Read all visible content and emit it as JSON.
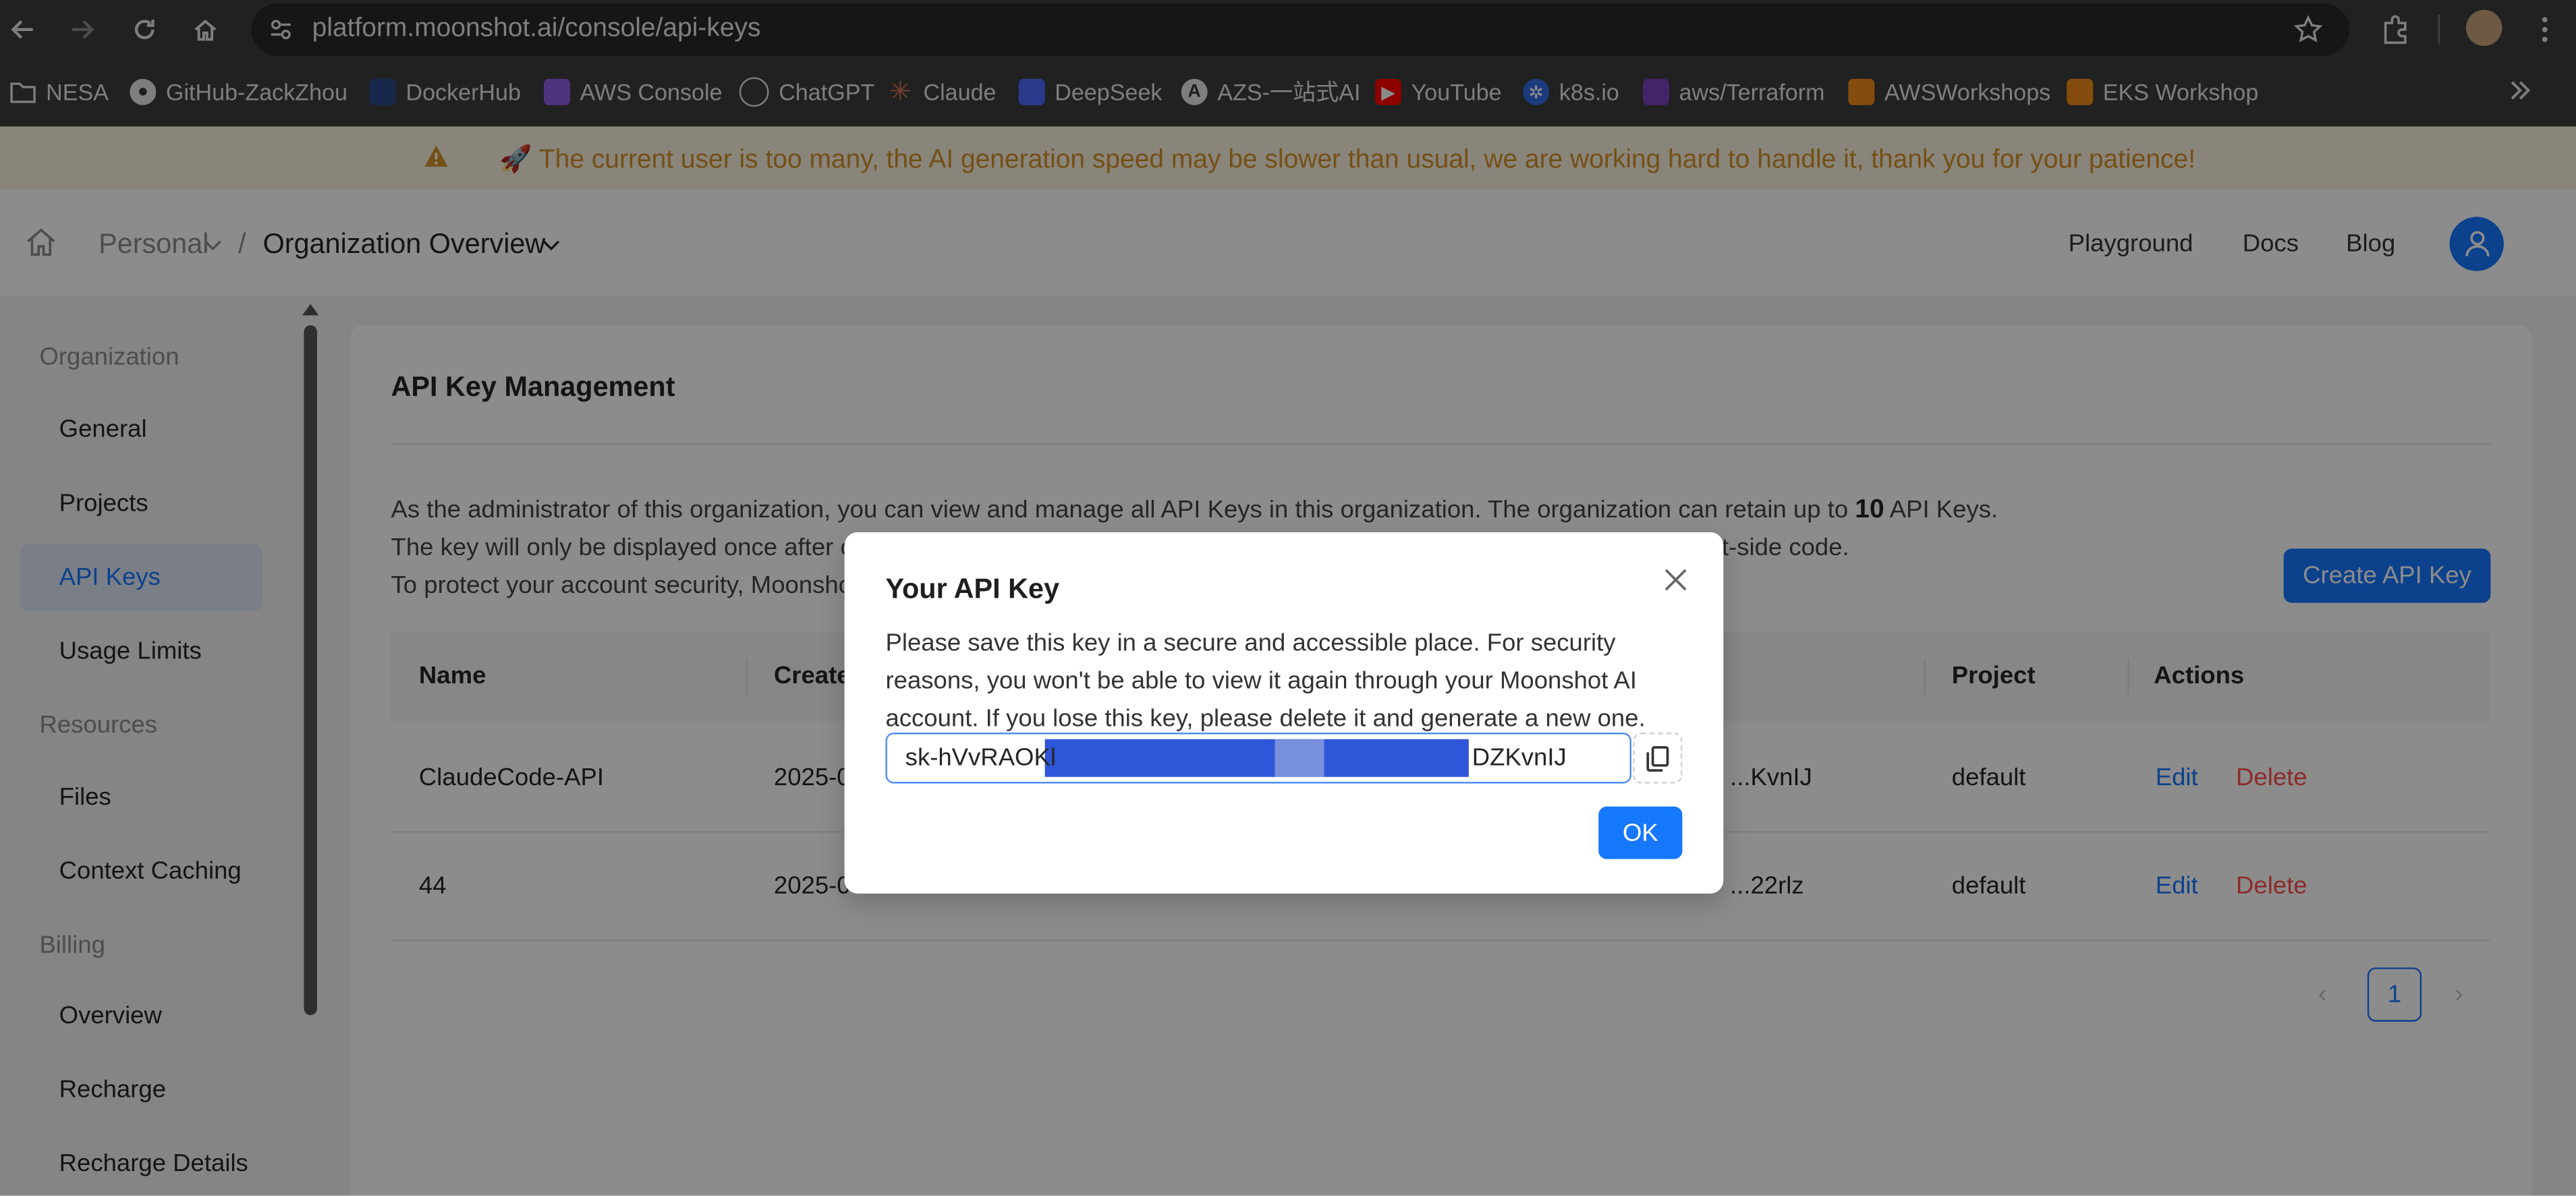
{
  "browser": {
    "url": "platform.moonshot.ai/console/api-keys",
    "bookmarks": [
      {
        "label": "NESA",
        "icon": "folder-icon"
      },
      {
        "label": "GitHub-ZackZhou",
        "icon": "github-icon"
      },
      {
        "label": "DockerHub",
        "icon": "docker-icon"
      },
      {
        "label": "AWS Console",
        "icon": "cube-icon"
      },
      {
        "label": "ChatGPT",
        "icon": "openai-icon"
      },
      {
        "label": "Claude",
        "icon": "claude-icon"
      },
      {
        "label": "DeepSeek",
        "icon": "deepseek-icon"
      },
      {
        "label": "AZS-一站式AI",
        "icon": "azs-icon"
      },
      {
        "label": "YouTube",
        "icon": "youtube-icon"
      },
      {
        "label": "k8s.io",
        "icon": "kubernetes-icon"
      },
      {
        "label": "aws/Terraform",
        "icon": "terraform-icon"
      },
      {
        "label": "AWSWorkshops",
        "icon": "aws-workshops-icon"
      },
      {
        "label": "EKS Workshop",
        "icon": "eks-icon"
      }
    ]
  },
  "banner": {
    "text": "🚀 The current user is too many, the AI generation speed may be slower than usual, we are working hard to handle it, thank you for your patience!"
  },
  "header": {
    "breadcrumb_personal": "Personal",
    "breadcrumb_separator": "/",
    "breadcrumb_org": "Organization Overview",
    "nav": [
      "Playground",
      "Docs",
      "Blog"
    ]
  },
  "sidebar": {
    "sections": [
      {
        "title": "Organization",
        "items": [
          "General",
          "Projects",
          "API Keys",
          "Usage Limits"
        ]
      },
      {
        "title": "Resources",
        "items": [
          "Files",
          "Context Caching"
        ]
      },
      {
        "title": "Billing",
        "items": [
          "Overview",
          "Recharge",
          "Recharge Details"
        ]
      }
    ],
    "active": "API Keys"
  },
  "main": {
    "title": "API Key Management",
    "desc_line1_pre": "As the administrator of this organization, you can view and manage all API Keys in this organization. The organization can retain up to ",
    "desc_line1_bold": "10",
    "desc_line1_post": " API Keys.",
    "desc_line2_start": "The key will only be displayed once after cre",
    "desc_line2_end": "t-side code.",
    "desc_line3_start": "To protect your account security, Moonshot",
    "create_button": "Create API Key",
    "table": {
      "headers": {
        "name": "Name",
        "created": "Created",
        "project": "Project",
        "actions": "Actions"
      },
      "rows": [
        {
          "name": "ClaudeCode-API",
          "created": "2025-0",
          "key_tail": "...KvnIJ",
          "project": "default",
          "edit": "Edit",
          "delete": "Delete"
        },
        {
          "name": "44",
          "created": "2025-0",
          "key_tail": "...22rlz",
          "project": "default",
          "edit": "Edit",
          "delete": "Delete"
        }
      ]
    },
    "pagination": {
      "current": "1"
    }
  },
  "modal": {
    "title": "Your API Key",
    "body": "Please save this key in a secure and accessible place. For security reasons, you won't be able to view it again through your Moonshot AI account. If you lose this key, please delete it and generate a new one.",
    "key_prefix": "sk-hVvRAOKl",
    "key_suffix": "DZKvnIJ",
    "ok_button": "OK"
  },
  "colors": {
    "primary": "#1677ff",
    "danger": "#ff4d4f",
    "banner_bg": "#fbf2de",
    "banner_text": "#d1922b",
    "chrome_bg": "#3c3c3c"
  }
}
